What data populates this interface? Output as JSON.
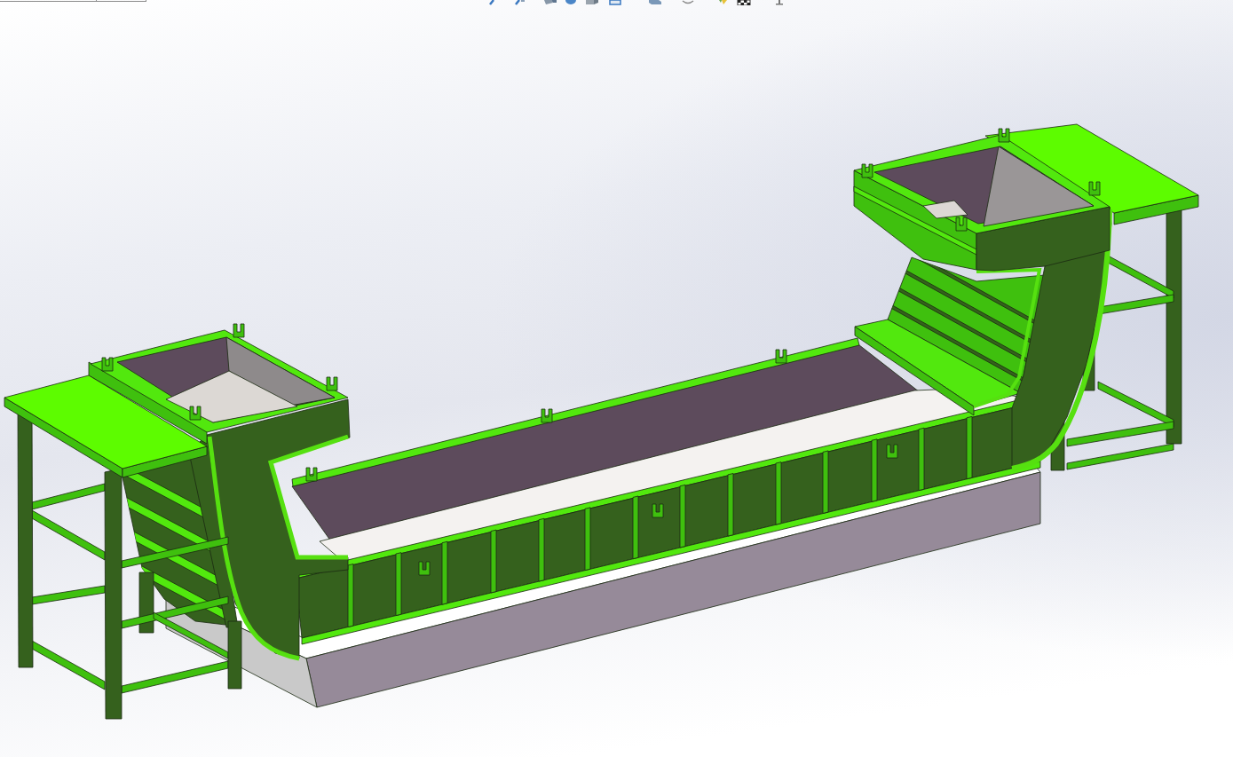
{
  "graphics_area": {
    "view_toolbar": [
      {
        "kind": "zoom-to-fit"
      },
      {
        "kind": "zoom-to-area"
      },
      {
        "kind": "previous-view"
      },
      {
        "kind": "section-view"
      },
      {
        "kind": "dynamic-annotation"
      },
      {
        "kind": "view-orientation"
      },
      {
        "kind": "display-style"
      },
      {
        "kind": "hide-show"
      },
      {
        "kind": "edit-appearance"
      },
      {
        "kind": "apply-scene"
      },
      {
        "kind": "view-settings"
      }
    ]
  }
}
